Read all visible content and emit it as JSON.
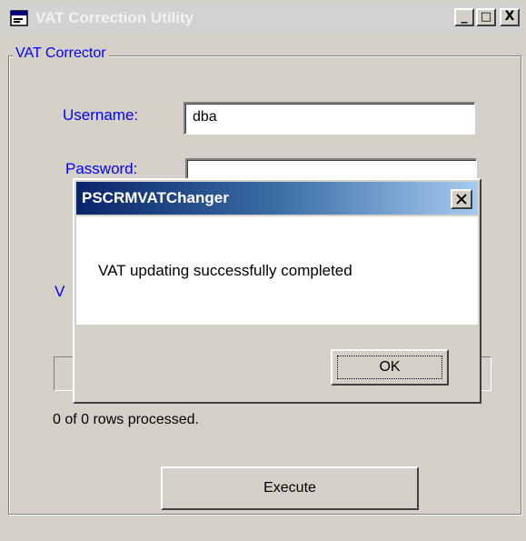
{
  "window": {
    "title": "VAT Correction Utility",
    "icon": "app-window-icon",
    "controls": {
      "minimize": "_",
      "maximize": "□",
      "close": "X"
    }
  },
  "group": {
    "legend": "VAT Corrector"
  },
  "form": {
    "username_label": "Username:",
    "username_value": "dba",
    "password_label": "Password:",
    "password_value": "",
    "partial_label": "V"
  },
  "status": {
    "rows_processed": "0 of 0 rows processed."
  },
  "execute_button": "Execute",
  "dialog": {
    "title": "PSCRMVATChanger",
    "message": "VAT updating successfully completed",
    "ok_button": "OK",
    "close_icon": "close-icon"
  },
  "colors": {
    "face": "#d4d0c8",
    "label_blue": "#0000ff",
    "active_title_start": "#0a246a",
    "active_title_end": "#a6caf0"
  }
}
